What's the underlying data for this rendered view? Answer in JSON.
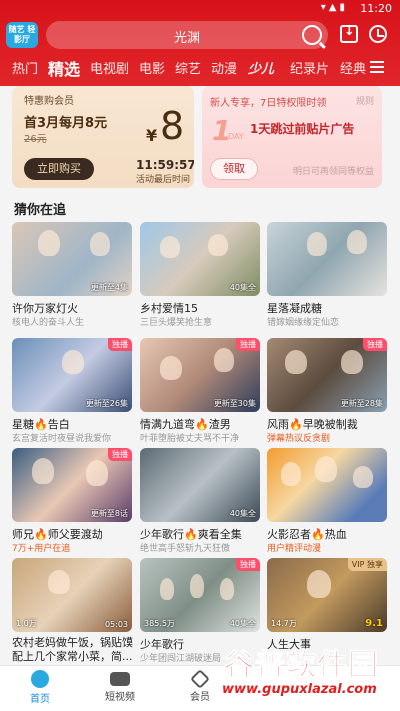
{
  "status_bar": {
    "time": "11:20"
  },
  "header": {
    "logo_text": "随艺 轻影厅",
    "search_text": "光渊",
    "tabs": [
      "热门",
      "精选",
      "电视剧",
      "电影",
      "综艺",
      "动漫",
      "少儿",
      "纪录片",
      "经典"
    ],
    "active_tab": "精选"
  },
  "promo_left": {
    "tag": "特惠购会员",
    "title": "首3月每月8元",
    "old_price": "26元",
    "price_symbol": "¥",
    "price": "8",
    "buy_label": "立即购买",
    "countdown": "11:59:57",
    "countdown_label": "活动最后时间"
  },
  "promo_right": {
    "tag": "新人专享，7日特权限时领",
    "rule": "规则",
    "big_number": "1",
    "big_unit": "DAY",
    "title": "1天跳过前贴片广告",
    "claim_label": "领取",
    "note": "明日可再领同等权益"
  },
  "section": {
    "title": "猜你在追"
  },
  "cards": [
    {
      "title": "许你万家灯火",
      "sub": "核电人的奋斗人生",
      "ep": "更新至4集",
      "badge": ""
    },
    {
      "title": "乡村爱情15",
      "sub": "三巨头爆笑抢生意",
      "ep": "40集全",
      "badge": ""
    },
    {
      "title": "星落凝成糖",
      "sub": "错嫁姻缘缘定仙恋",
      "ep": "",
      "badge": ""
    },
    {
      "title": "星糖🔥告白",
      "sub": "玄宫复活时夜昼说我爱你",
      "ep": "更新至26集",
      "badge": "独播"
    },
    {
      "title": "情满九道弯🔥渣男",
      "sub": "叶菲堕胎被丈夫骂不干净",
      "ep": "更新至30集",
      "badge": "独播"
    },
    {
      "title": "风雨🔥早晚被制裁",
      "sub": "弹幕热议反贪剧",
      "ep": "更新至28集",
      "badge": "独播",
      "hot": true
    },
    {
      "title": "师兄🔥师父要渡劫",
      "sub": "7万+用户在追",
      "ep": "更新至8话",
      "badge": "独播",
      "hot": true
    },
    {
      "title": "少年歌行🔥爽看全集",
      "sub": "绝世高手怒斩九天狂傲",
      "ep": "40集全",
      "badge": ""
    },
    {
      "title": "火影忍者🔥热血",
      "sub": "用户精评动漫",
      "ep": "",
      "badge": "",
      "hot": true
    },
    {
      "title": "农村老妈做午饭，锅贴馍配上几个家常小菜，简...",
      "sub": "",
      "ep": "05:03",
      "play": "1.0万",
      "badge": ""
    },
    {
      "title": "少年歌行",
      "sub": "少年团闯江湖破迷局",
      "ep": "40集全",
      "play": "385.5万",
      "badge": "独播"
    },
    {
      "title": "人生大事",
      "sub": "",
      "ep": "9.1",
      "play": "14.7万",
      "badge": "VIP 独享"
    }
  ],
  "bottom_nav": [
    {
      "label": "首页"
    },
    {
      "label": "短视频"
    },
    {
      "label": "会员"
    }
  ],
  "watermark": {
    "main": "谷普软件园",
    "url": "www.gupuxlazal.com"
  }
}
